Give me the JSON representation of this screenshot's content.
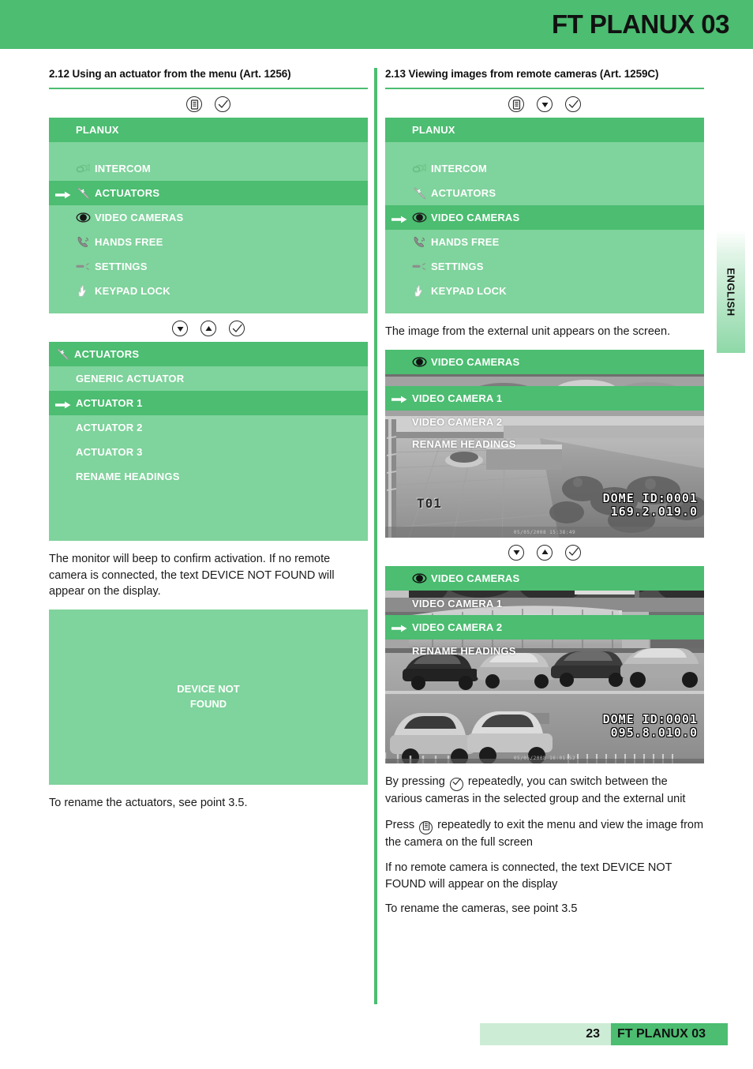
{
  "header": {
    "title": "FT PLANUX 03"
  },
  "lang_tab": {
    "label": "ENGLISH"
  },
  "colors": {
    "green_dark": "#4cbd71",
    "green_light": "#7fd39c",
    "footer_light": "#cdecd6"
  },
  "left": {
    "heading": "2.12 Using an actuator from the menu (Art. 1256)",
    "keys_top": [
      {
        "name": "menu-key",
        "icon": "menu-icon"
      },
      {
        "name": "confirm-key",
        "icon": "check-icon"
      }
    ],
    "menu1": {
      "title": "PLANUX",
      "items": [
        {
          "label": "INTERCOM",
          "icon": "intercom-icon",
          "selected": false,
          "arrow": false
        },
        {
          "label": "ACTUATORS",
          "icon": "actuator-icon",
          "selected": true,
          "arrow": true
        },
        {
          "label": "VIDEO CAMERAS",
          "icon": "camera-eye-icon",
          "selected": false,
          "arrow": false
        },
        {
          "label": "HANDS FREE",
          "icon": "handsfree-icon",
          "selected": false,
          "arrow": false
        },
        {
          "label": "SETTINGS",
          "icon": "wrench-icon",
          "selected": false,
          "arrow": false
        },
        {
          "label": "KEYPAD LOCK",
          "icon": "hand-icon",
          "selected": false,
          "arrow": false
        }
      ]
    },
    "keys_mid": [
      {
        "name": "down-key",
        "icon": "down-arrow-icon"
      },
      {
        "name": "up-key",
        "icon": "up-arrow-icon"
      },
      {
        "name": "confirm-key",
        "icon": "check-icon"
      }
    ],
    "menu2": {
      "title": "ACTUATORS",
      "title_icon": "actuator-icon",
      "items": [
        {
          "label": "GENERIC ACTUATOR",
          "selected": false,
          "arrow": false
        },
        {
          "label": "ACTUATOR 1",
          "selected": true,
          "arrow": true
        },
        {
          "label": "ACTUATOR 2",
          "selected": false,
          "arrow": false
        },
        {
          "label": "ACTUATOR 3",
          "selected": false,
          "arrow": false
        },
        {
          "label": "RENAME HEADINGS",
          "selected": false,
          "arrow": false
        }
      ]
    },
    "para1": "The monitor will beep to confirm activation. If no remote camera is connected, the text DEVICE NOT FOUND will appear on the display.",
    "device_not_found": "DEVICE NOT\nFOUND",
    "para2": "To rename the actuators, see point 3.5."
  },
  "right": {
    "heading": "2.13 Viewing images from remote cameras (Art. 1259C)",
    "keys_top": [
      {
        "name": "menu-key",
        "icon": "menu-icon"
      },
      {
        "name": "down-key",
        "icon": "down-arrow-icon"
      },
      {
        "name": "confirm-key",
        "icon": "check-icon"
      }
    ],
    "menu1": {
      "title": "PLANUX",
      "items": [
        {
          "label": "INTERCOM",
          "icon": "intercom-icon",
          "selected": false,
          "arrow": false
        },
        {
          "label": "ACTUATORS",
          "icon": "actuator-icon",
          "selected": false,
          "arrow": false
        },
        {
          "label": "VIDEO CAMERAS",
          "icon": "camera-eye-icon",
          "selected": true,
          "arrow": true
        },
        {
          "label": "HANDS FREE",
          "icon": "handsfree-icon",
          "selected": false,
          "arrow": false
        },
        {
          "label": "SETTINGS",
          "icon": "wrench-icon",
          "selected": false,
          "arrow": false
        },
        {
          "label": "KEYPAD LOCK",
          "icon": "hand-icon",
          "selected": false,
          "arrow": false
        }
      ]
    },
    "para1": "The image from the external unit appears on the screen.",
    "cam1": {
      "title": "VIDEO CAMERAS",
      "title_icon": "camera-eye-icon",
      "items": [
        {
          "label": "VIDEO CAMERA 1",
          "selected": true,
          "arrow": true
        },
        {
          "label": "VIDEO CAMERA 2",
          "selected": false,
          "arrow": false
        },
        {
          "label": "RENAME HEADINGS",
          "selected": false,
          "arrow": false
        }
      ],
      "tcode": "T01",
      "osd_line1": "DOME ID:0001",
      "osd_line2": "169.2.019.0",
      "stamp": "05/05/2008 15:38:49"
    },
    "keys_mid": [
      {
        "name": "down-key",
        "icon": "down-arrow-icon"
      },
      {
        "name": "up-key",
        "icon": "up-arrow-icon"
      },
      {
        "name": "confirm-key",
        "icon": "check-icon"
      }
    ],
    "cam2": {
      "title": "VIDEO CAMERAS",
      "title_icon": "camera-eye-icon",
      "items": [
        {
          "label": "VIDEO CAMERA 1",
          "selected": false,
          "arrow": false
        },
        {
          "label": "VIDEO CAMERA 2",
          "selected": true,
          "arrow": true
        },
        {
          "label": "RENAME HEADINGS",
          "selected": false,
          "arrow": false
        }
      ],
      "osd_line1": "DOME ID:0001",
      "osd_line2": "095.8.010.0",
      "stamp": "05/05/2008 16:01:52"
    },
    "para2_a": "By pressing",
    "para2_b": "repeatedly, you can switch between the various cameras in the selected group and the external unit",
    "para3_a": "Press",
    "para3_b": "repeatedly to exit the menu and view the image from the camera on the full screen",
    "para4": "If no remote camera is connected, the text DEVICE NOT FOUND will appear on the display",
    "para5": "To rename the cameras, see point 3.5"
  },
  "footer": {
    "page_number": "23",
    "title": "FT PLANUX 03"
  }
}
